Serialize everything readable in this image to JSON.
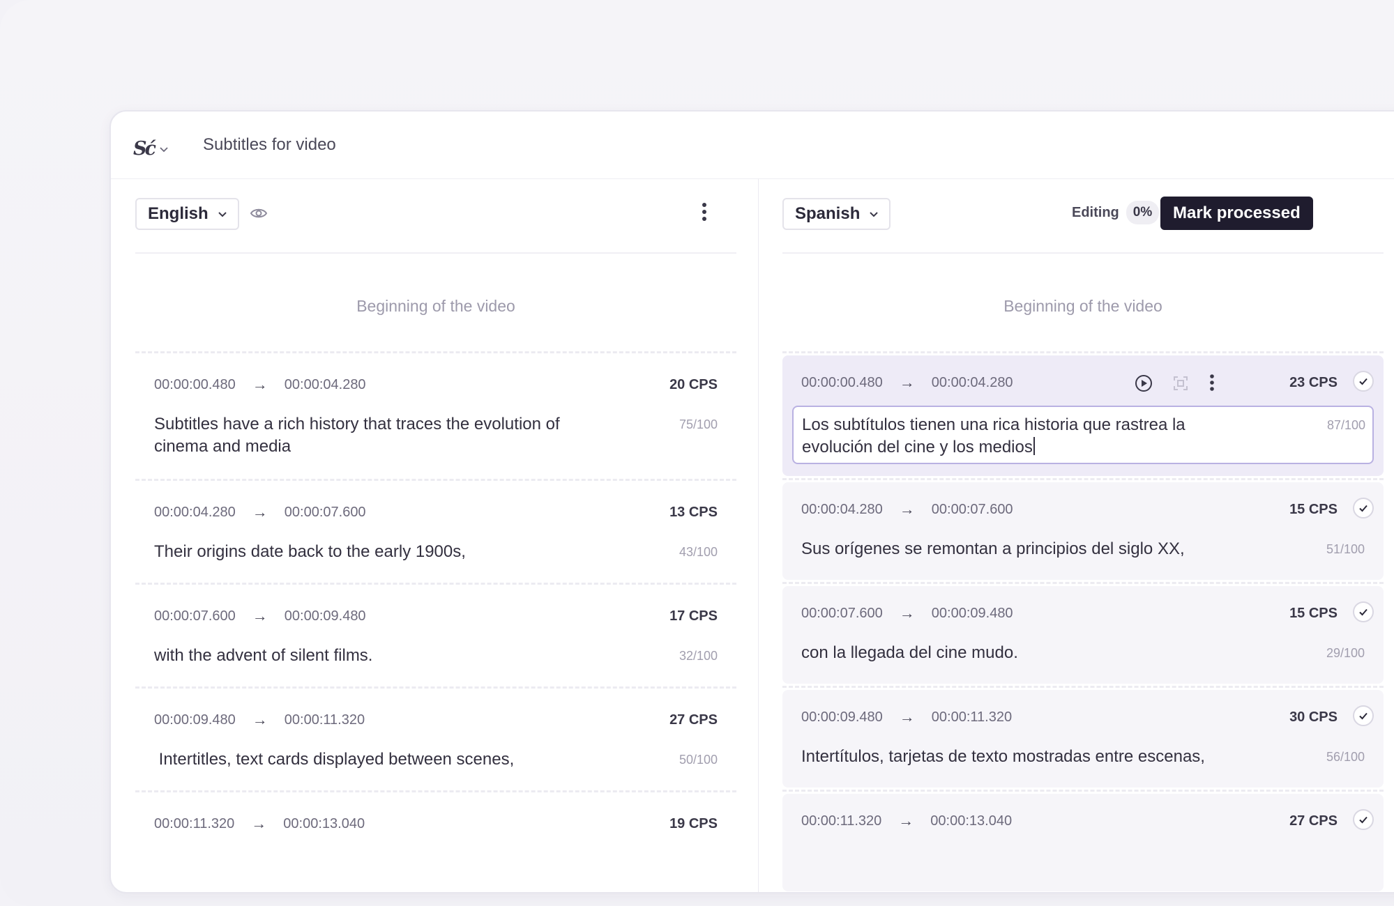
{
  "window": {
    "title": "Subtitles for video",
    "logo": "Sć"
  },
  "left_pane": {
    "language": "English",
    "beginning": "Beginning of the video",
    "rows": [
      {
        "start": "00:00:00.480",
        "end": "00:00:04.280",
        "cps": "20 CPS",
        "text": "Subtitles have a rich history that traces the evolution of cinema and media",
        "count": "75/100"
      },
      {
        "start": "00:00:04.280",
        "end": "00:00:07.600",
        "cps": "13 CPS",
        "text": "Their origins date back to the early 1900s,",
        "count": "43/100"
      },
      {
        "start": "00:00:07.600",
        "end": "00:00:09.480",
        "cps": "17 CPS",
        "text": "with the advent of silent films.",
        "count": "32/100"
      },
      {
        "start": "00:00:09.480",
        "end": "00:00:11.320",
        "cps": "27 CPS",
        "text": " Intertitles, text cards displayed between scenes,",
        "count": "50/100"
      },
      {
        "start": "00:00:11.320",
        "end": "00:00:13.040",
        "cps": "19 CPS",
        "text": "",
        "count": ""
      }
    ]
  },
  "right_pane": {
    "language": "Spanish",
    "editing_label": "Editing",
    "editing_percent": "0%",
    "mark_processed": "Mark processed",
    "beginning": "Beginning of the video",
    "rows": [
      {
        "start": "00:00:00.480",
        "end": "00:00:04.280",
        "cps": "23 CPS",
        "text": "Los subtítulos tienen una rica historia que rastrea la evolución del cine y los medios",
        "count": "87/100"
      },
      {
        "start": "00:00:04.280",
        "end": "00:00:07.600",
        "cps": "15 CPS",
        "text": "Sus orígenes se remontan a principios del siglo XX,",
        "count": "51/100"
      },
      {
        "start": "00:00:07.600",
        "end": "00:00:09.480",
        "cps": "15 CPS",
        "text": "con la llegada del cine mudo.",
        "count": "29/100"
      },
      {
        "start": "00:00:09.480",
        "end": "00:00:11.320",
        "cps": "30 CPS",
        "text": "Intertítulos, tarjetas de texto mostradas entre escenas,",
        "count": "56/100"
      },
      {
        "start": "00:00:11.320",
        "end": "00:00:13.040",
        "cps": "27 CPS",
        "text": "",
        "count": ""
      }
    ]
  },
  "arrow": "→"
}
